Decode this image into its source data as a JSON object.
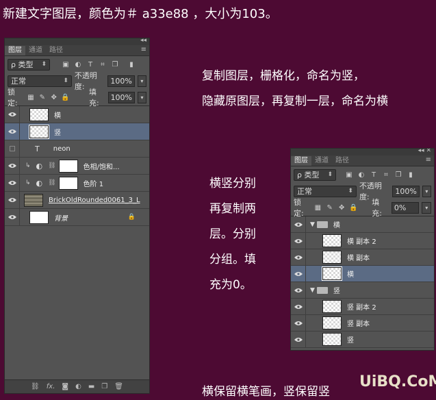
{
  "captions": {
    "top": "新建文字图层，颜色为＃ a33e88 ，大小为103。",
    "right1": "复制图层，栅格化，命名为竖，",
    "right2": "隐藏原图层，再复制一层，命名为横",
    "mid1": "横竖分别",
    "mid2": "再复制两",
    "mid3": "层。分别",
    "mid4": "分组。填",
    "mid5": "充为0。",
    "bottom": "横保留横笔画，竖保留竖",
    "watermark": "UiBQ.CoM"
  },
  "panel1": {
    "tabs": [
      "图层",
      "通道",
      "路径"
    ],
    "filter_label": "ρ 类型",
    "blend_mode": "正常",
    "opacity_label": "不透明度:",
    "opacity": "100%",
    "lock_label": "锁定:",
    "fill_label": "填充:",
    "fill": "100%",
    "layers": [
      {
        "name": "横",
        "visible": true,
        "thumb": "checker"
      },
      {
        "name": "竖",
        "visible": true,
        "thumb": "checker",
        "selected": true
      },
      {
        "name": "neon",
        "visible": false,
        "thumb": "text"
      },
      {
        "name": "色相/饱和...",
        "visible": true,
        "thumb": "adjust"
      },
      {
        "name": "色阶 1",
        "visible": true,
        "thumb": "adjust"
      },
      {
        "name": "BrickOldRounded0061_3_L",
        "visible": true,
        "thumb": "brick"
      },
      {
        "name": "背景",
        "visible": true,
        "thumb": "white"
      }
    ],
    "bottom_icons": [
      "link-icon",
      "fx-icon",
      "mask-icon",
      "adjustment-icon",
      "folder-icon",
      "new-layer-icon",
      "trash-icon"
    ],
    "fx_label": "fx."
  },
  "panel2": {
    "tabs": [
      "图层",
      "通道",
      "路径"
    ],
    "filter_label": "ρ 类型",
    "blend_mode": "正常",
    "opacity_label": "不透明度:",
    "opacity": "100%",
    "lock_label": "锁定:",
    "fill_label": "填充:",
    "fill": "0%",
    "layers": [
      {
        "name": "横",
        "type": "group"
      },
      {
        "name": "横 副本 2",
        "type": "layer"
      },
      {
        "name": "横 副本",
        "type": "layer"
      },
      {
        "name": "横",
        "type": "layer",
        "selected": true
      },
      {
        "name": "竖",
        "type": "group"
      },
      {
        "name": "竖 副本 2",
        "type": "layer"
      },
      {
        "name": "竖 副本",
        "type": "layer"
      },
      {
        "name": "竖",
        "type": "layer"
      }
    ]
  }
}
